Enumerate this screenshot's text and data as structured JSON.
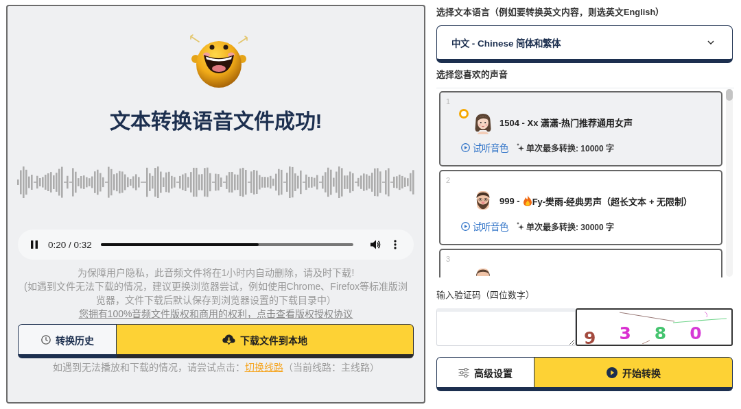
{
  "result": {
    "title": "文本转换语音文件成功!",
    "player": {
      "playing": true,
      "time": "0:20 / 0:32",
      "level": 0.625
    },
    "notices": [
      "为保障用户隐私，此音频文件将在1小时内自动删除，请及时下载!",
      "(如遇到文件无法下载的情况，建议更换浏览器尝试，例如使用Chrome、Firefox等标准版浏览器，文件下载后默认保存到浏览器设置的下载目录中）"
    ],
    "license_link": "您拥有100%音频文件版权和商用的权利，点击查看版权授权协议",
    "buttons": [
      {
        "kind": "history",
        "label": "转换历史"
      },
      {
        "kind": "download",
        "label": "下载文件到本地"
      }
    ],
    "route_hint": {
      "before": "如遇到无法播放和下载的情况，请尝试点击：",
      "link": "切换线路",
      "after": "（当前线路：主线路）"
    }
  },
  "settings": {
    "language_label": "选择文本语言（例如要转换英文内容，则选英文English）",
    "language": {
      "value": "中文 - Chinese 简体和繁体"
    },
    "voice_label": "选择您喜欢的声音",
    "voices": [
      {
        "number": "1",
        "selected": true,
        "kind": "woman",
        "name": "1504 - Xx 潇潇-热门推荐通用女声",
        "hot": false,
        "listen": "试听音色",
        "limit": "单次最多转换: 10000 字"
      },
      {
        "number": "2",
        "selected": false,
        "kind": "beard",
        "name": "999 -",
        "hot": true,
        "name_after_icon": "Fy-樊雨-经典男声（超长文本 + 无限制）",
        "listen": "试听音色",
        "limit": "单次最多转换: 30000 字"
      },
      {
        "number": "3",
        "selected": false,
        "kind": "man",
        "hot": false
      }
    ],
    "captcha_label": "输入验证码（四位数字）",
    "captcha": {
      "digits": [
        {
          "text": "9",
          "color": "#a34a3e"
        },
        {
          "text": "3",
          "color": "#d92fd0"
        },
        {
          "text": "8",
          "color": "#45c46f"
        },
        {
          "text": "0",
          "color": "#d63ad6"
        }
      ]
    },
    "buttons": [
      {
        "kind": "settings",
        "label": "高级设置"
      },
      {
        "kind": "start",
        "label": "开始转换"
      }
    ]
  }
}
